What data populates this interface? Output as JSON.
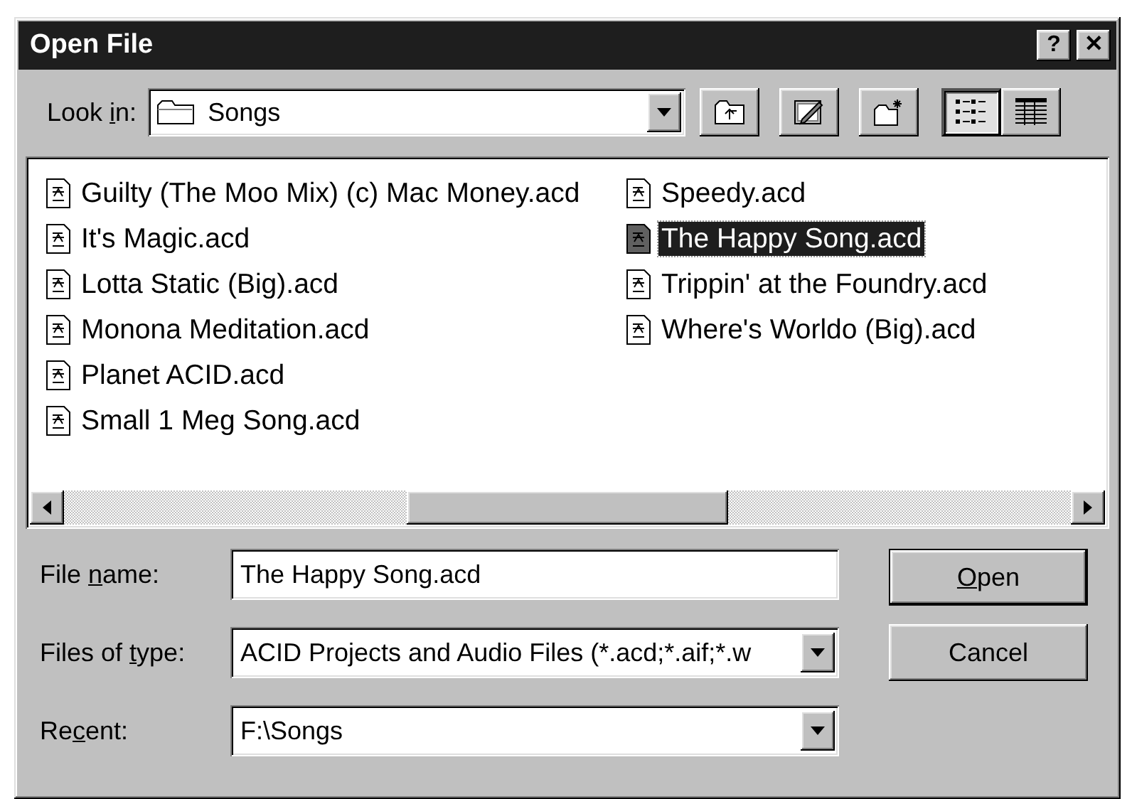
{
  "window": {
    "title": "Open File",
    "help": "?",
    "close": "✕"
  },
  "look_in": {
    "label_parts": [
      {
        "text": "Look ",
        "u": false
      },
      {
        "text": "i",
        "u": true
      },
      {
        "text": "n:",
        "u": false
      }
    ],
    "value": "Songs"
  },
  "toolbar": [
    {
      "kind": "up-folder"
    },
    {
      "kind": "pencil"
    },
    {
      "kind": "new-folder"
    }
  ],
  "views": [
    {
      "kind": "list",
      "selected": true
    },
    {
      "kind": "details",
      "selected": false
    }
  ],
  "files": {
    "columns": [
      {
        "items": [
          {
            "name": "Guilty (The Moo Mix) (c) Mac Money.acd",
            "selected": false
          },
          {
            "name": "It's Magic.acd",
            "selected": false
          },
          {
            "name": "Lotta Static (Big).acd",
            "selected": false
          },
          {
            "name": "Monona Meditation.acd",
            "selected": false
          },
          {
            "name": "Planet ACID.acd",
            "selected": false
          },
          {
            "name": "Small 1 Meg Song.acd",
            "selected": false
          }
        ]
      },
      {
        "items": [
          {
            "name": "Speedy.acd",
            "selected": false
          },
          {
            "name": "The Happy Song.acd",
            "selected": true
          },
          {
            "name": "Trippin' at the Foundry.acd",
            "selected": false
          },
          {
            "name": "Where's Worldo (Big).acd",
            "selected": false
          }
        ]
      }
    ]
  },
  "fields": [
    {
      "kind": "text",
      "label_parts": [
        {
          "text": "File ",
          "u": false
        },
        {
          "text": "n",
          "u": true
        },
        {
          "text": "ame:",
          "u": false
        }
      ],
      "value": "The Happy Song.acd"
    },
    {
      "kind": "combo",
      "label_parts": [
        {
          "text": "Files of ",
          "u": false
        },
        {
          "text": "t",
          "u": true
        },
        {
          "text": "ype:",
          "u": false
        }
      ],
      "value": "ACID Projects and Audio Files (*.acd;*.aif;*.w"
    },
    {
      "kind": "combo",
      "label_parts": [
        {
          "text": "Re",
          "u": false
        },
        {
          "text": "c",
          "u": true
        },
        {
          "text": "ent:",
          "u": false
        }
      ],
      "value": "F:\\Songs"
    }
  ],
  "buttons": [
    {
      "default": true,
      "label_parts": [
        {
          "text": "O",
          "u": true
        },
        {
          "text": "pen",
          "u": false
        }
      ]
    },
    {
      "default": false,
      "label_parts": [
        {
          "text": "Cancel",
          "u": false
        }
      ]
    }
  ]
}
